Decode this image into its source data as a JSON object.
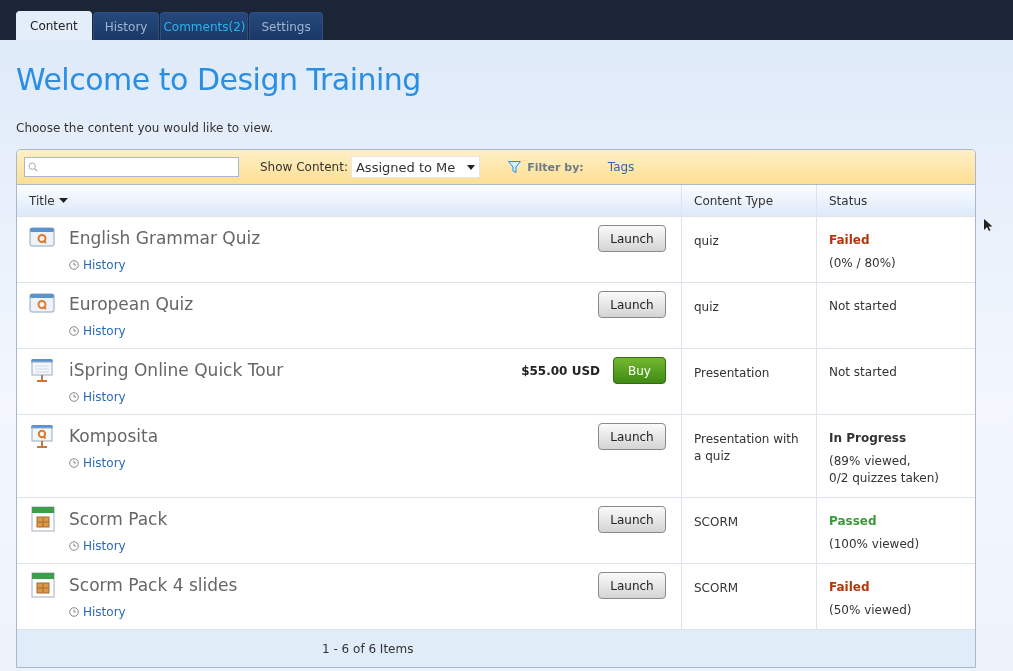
{
  "tabs": [
    {
      "label": "Content",
      "selected": true,
      "highlighted": false
    },
    {
      "label": "History",
      "selected": false,
      "highlighted": false
    },
    {
      "label": "Comments(2)",
      "selected": false,
      "highlighted": true
    },
    {
      "label": "Settings",
      "selected": false,
      "highlighted": false
    }
  ],
  "heading": "Welcome to Design Training",
  "intro": "Choose the content you would like to view.",
  "toolbar": {
    "show_content_label": "Show Content:",
    "show_content_value": "Assigned to Me",
    "filter_label": "Filter by:",
    "filter_link": "Tags"
  },
  "table": {
    "columns": [
      {
        "label": "Title",
        "sorted": true
      },
      {
        "label": "Content Type",
        "sorted": false
      },
      {
        "label": "Status",
        "sorted": false
      }
    ],
    "rows": [
      {
        "kind": "quiz",
        "title": "English Grammar Quiz",
        "history": "History",
        "action": {
          "kind": "launch",
          "label": "Launch"
        },
        "content_type": "quiz",
        "status": {
          "kind": "failed",
          "label": "Failed",
          "detail": "(0% / 80%)"
        }
      },
      {
        "kind": "quiz",
        "title": "European Quiz",
        "history": "History",
        "action": {
          "kind": "launch",
          "label": "Launch"
        },
        "content_type": "quiz",
        "status": {
          "kind": "not_started",
          "label": "Not started"
        }
      },
      {
        "kind": "presentation",
        "title": "iSpring Online Quick Tour",
        "history": "History",
        "action": {
          "kind": "buy",
          "label": "Buy",
          "price": "$55.00 USD"
        },
        "content_type": "Presentation",
        "status": {
          "kind": "not_started",
          "label": "Not started"
        }
      },
      {
        "kind": "presentation_quiz",
        "title": "Komposita",
        "history": "History",
        "action": {
          "kind": "launch",
          "label": "Launch"
        },
        "content_type": "Presentation with a quiz",
        "status": {
          "kind": "in_progress",
          "label": "In Progress",
          "detail": "(89% viewed,\n0/2 quizzes taken)"
        }
      },
      {
        "kind": "scorm",
        "title": "Scorm Pack",
        "history": "History",
        "action": {
          "kind": "launch",
          "label": "Launch"
        },
        "content_type": "SCORM",
        "status": {
          "kind": "passed",
          "label": "Passed",
          "detail": "(100% viewed)"
        }
      },
      {
        "kind": "scorm",
        "title": "Scorm Pack 4 slides",
        "history": "History",
        "action": {
          "kind": "launch",
          "label": "Launch"
        },
        "content_type": "SCORM",
        "status": {
          "kind": "failed",
          "label": "Failed",
          "detail": "(50% viewed)"
        }
      }
    ],
    "pager": "1 - 6 of 6 Items"
  }
}
